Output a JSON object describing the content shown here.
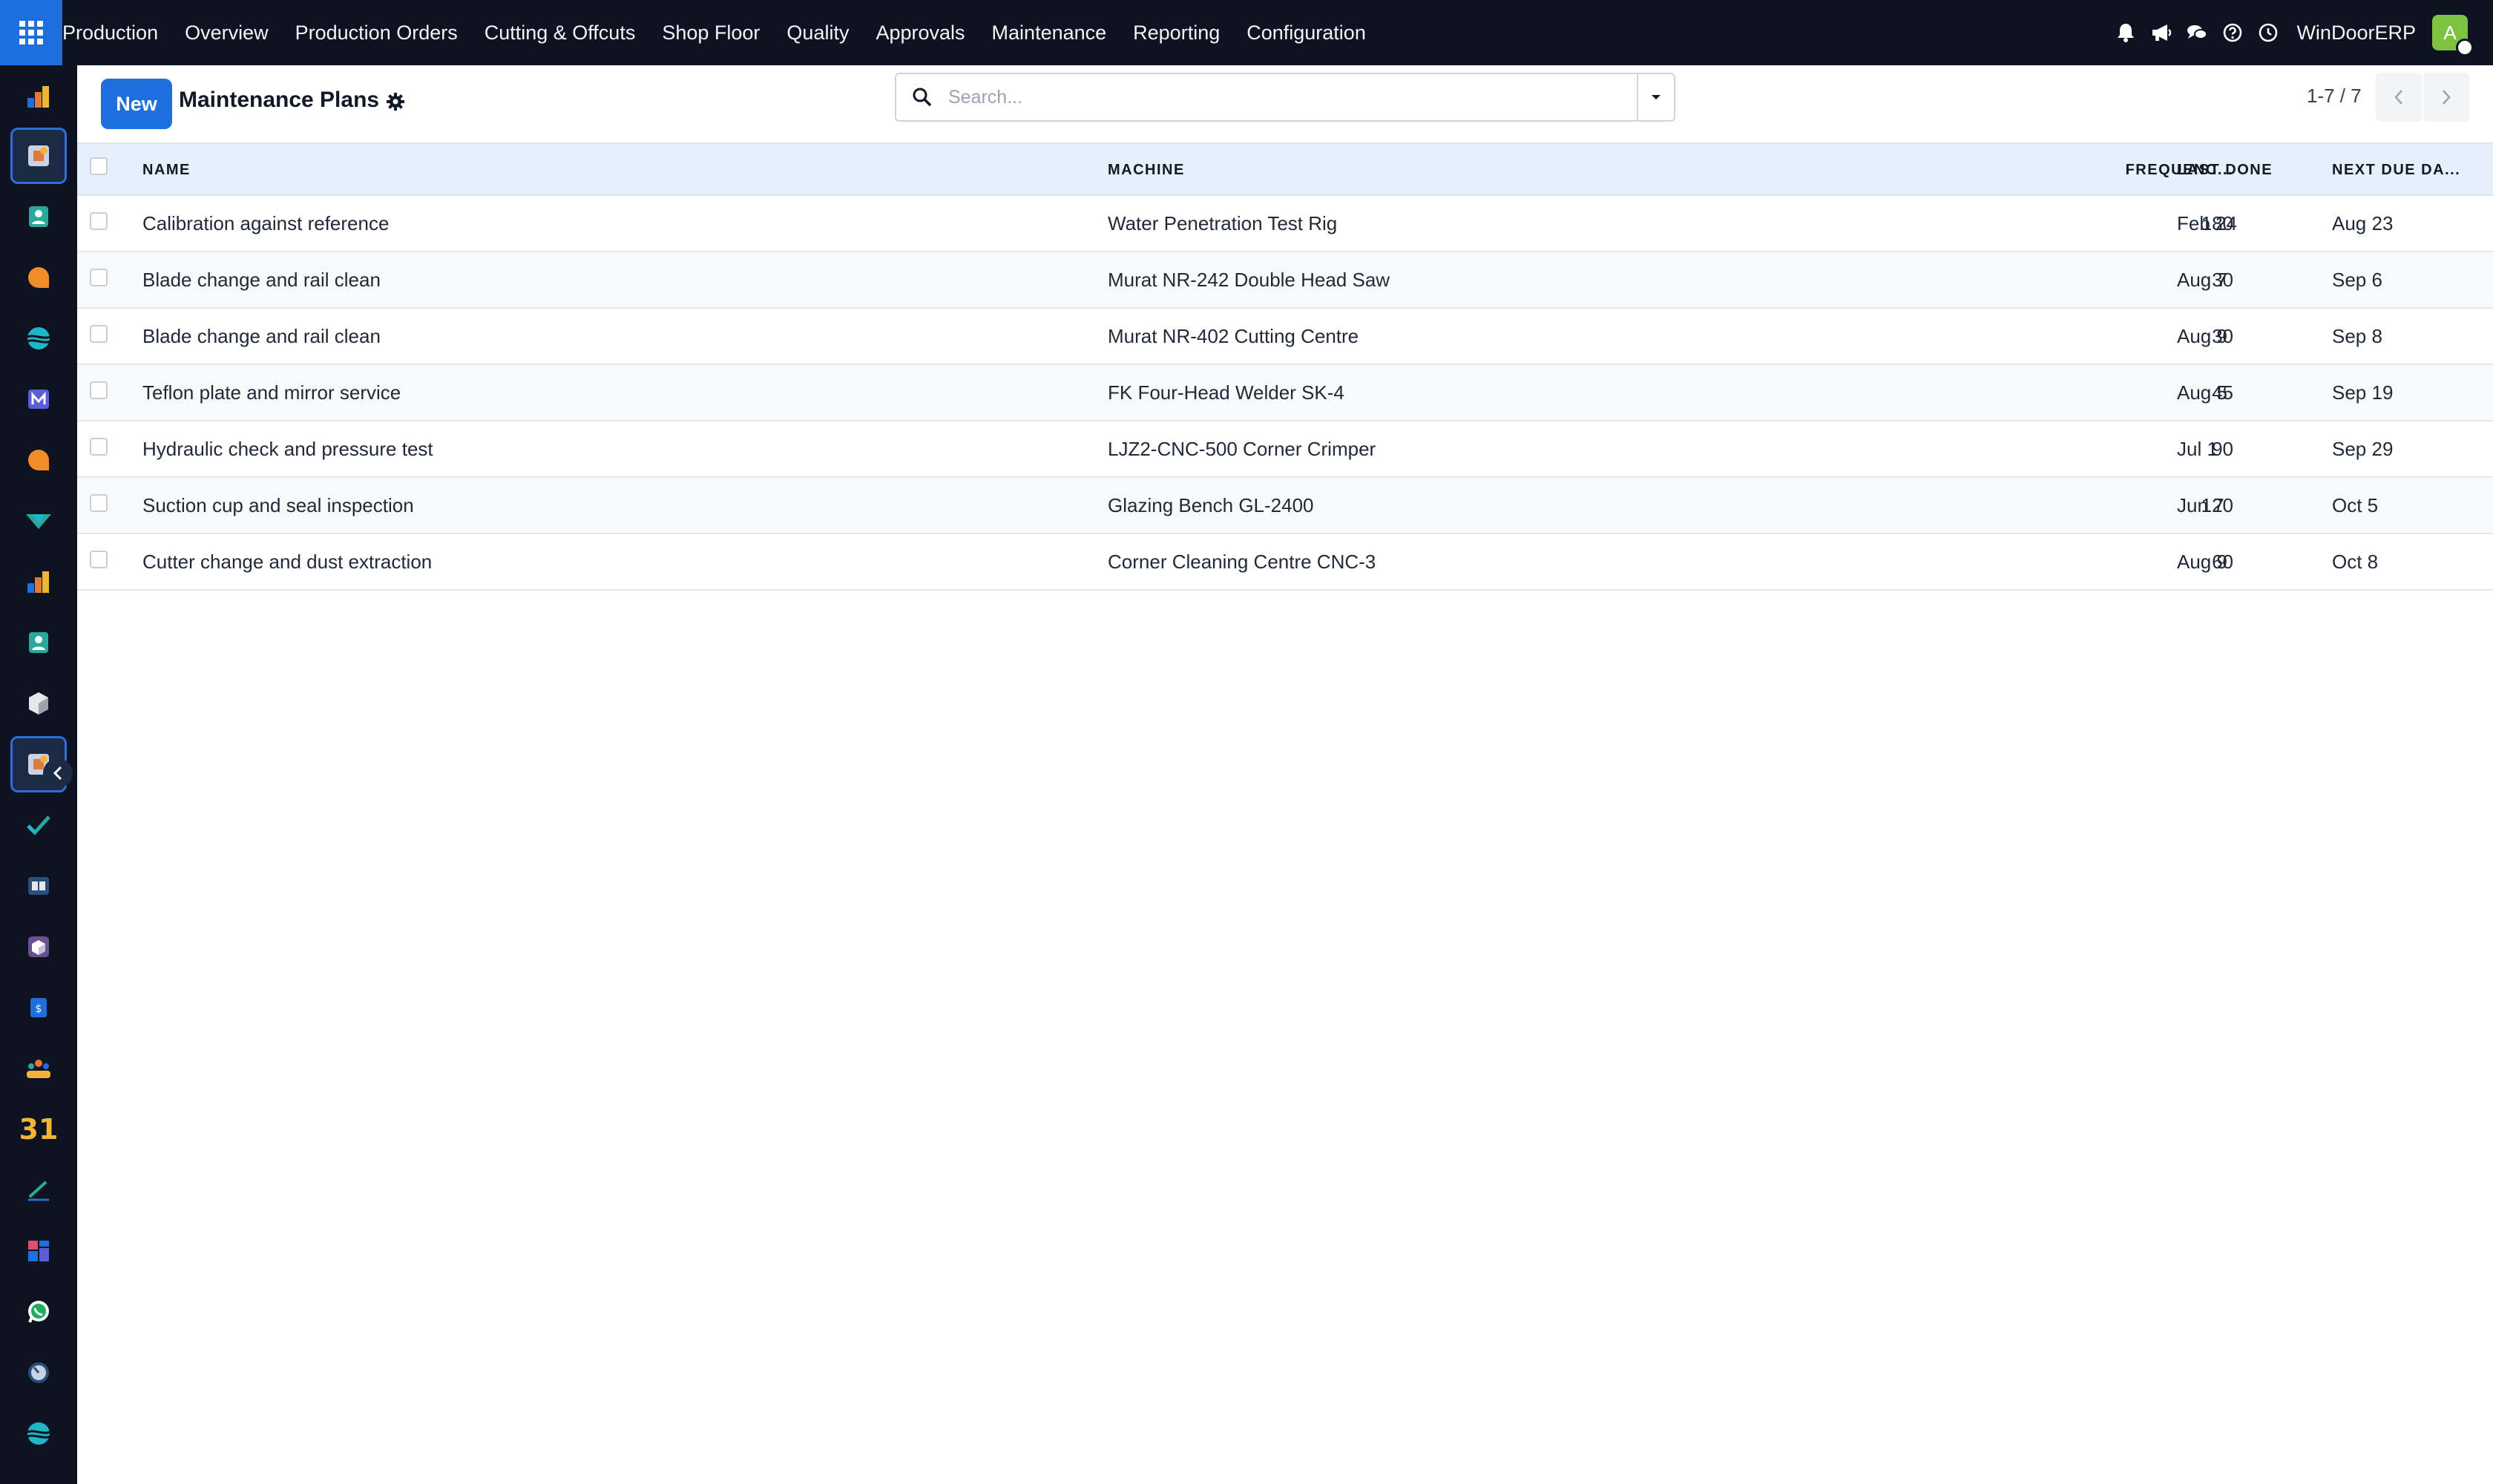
{
  "navbar": {
    "brand": "Production",
    "menu": [
      "Overview",
      "Production Orders",
      "Cutting & Offcuts",
      "Shop Floor",
      "Quality",
      "Approvals",
      "Maintenance",
      "Reporting",
      "Configuration"
    ],
    "icons": [
      "bell-icon",
      "megaphone-icon",
      "chat-icon",
      "help-icon",
      "clock-icon"
    ],
    "company": "WinDoorERP",
    "avatar_letter": "A"
  },
  "sidebar": {
    "items": [
      "bar-chart-app-icon",
      "production-app-icon",
      "contacts-app-icon",
      "discuss-app-icon",
      "surveys-app-icon",
      "mail-app-icon",
      "chat-app-icon",
      "discount-app-icon",
      "reporting-app-icon",
      "employees-app-icon",
      "inventory-app-icon",
      "production-app-icon",
      "tasks-app-icon",
      "knowledge-app-icon",
      "cube-app-icon",
      "invoicing-app-icon",
      "team-app-icon",
      "calendar-app-icon",
      "sign-app-icon",
      "dashboards-app-icon",
      "whatsapp-app-icon",
      "timer-app-icon",
      "waves-app-icon"
    ],
    "active_indexes": [
      1,
      11
    ],
    "calendar_label": "31"
  },
  "control": {
    "new_label": "New",
    "title": "Maintenance Plans",
    "search_placeholder": "Search...",
    "pager": "1-7 / 7"
  },
  "table": {
    "columns": {
      "name": "NAME",
      "machine": "MACHINE",
      "frequency": "FREQUENC...",
      "last_done": "LAST DONE",
      "next_due": "NEXT DUE DA..."
    },
    "rows": [
      {
        "name": "Calibration against reference",
        "machine": "Water Penetration Test Rig",
        "frequency": "180",
        "last_done": "Feb 24",
        "next_due": "Aug 23"
      },
      {
        "name": "Blade change and rail clean",
        "machine": "Murat NR-242 Double Head Saw",
        "frequency": "30",
        "last_done": "Aug 7",
        "next_due": "Sep 6"
      },
      {
        "name": "Blade change and rail clean",
        "machine": "Murat NR-402 Cutting Centre",
        "frequency": "30",
        "last_done": "Aug 9",
        "next_due": "Sep 8"
      },
      {
        "name": "Teflon plate and mirror service",
        "machine": "FK Four-Head Welder SK-4",
        "frequency": "45",
        "last_done": "Aug 5",
        "next_due": "Sep 19"
      },
      {
        "name": "Hydraulic check and pressure test",
        "machine": "LJZ2-CNC-500 Corner Crimper",
        "frequency": "90",
        "last_done": "Jul 1",
        "next_due": "Sep 29"
      },
      {
        "name": "Suction cup and seal inspection",
        "machine": "Glazing Bench GL-2400",
        "frequency": "120",
        "last_done": "Jun 7",
        "next_due": "Oct 5"
      },
      {
        "name": "Cutter change and dust extraction",
        "machine": "Corner Cleaning Centre CNC-3",
        "frequency": "60",
        "last_done": "Aug 9",
        "next_due": "Oct 8"
      }
    ]
  },
  "colors": {
    "navbar_bg": "#0d1321",
    "accent": "#1d6fe0",
    "header_bg": "#e6f0fc",
    "avatar": "#7cc342"
  }
}
